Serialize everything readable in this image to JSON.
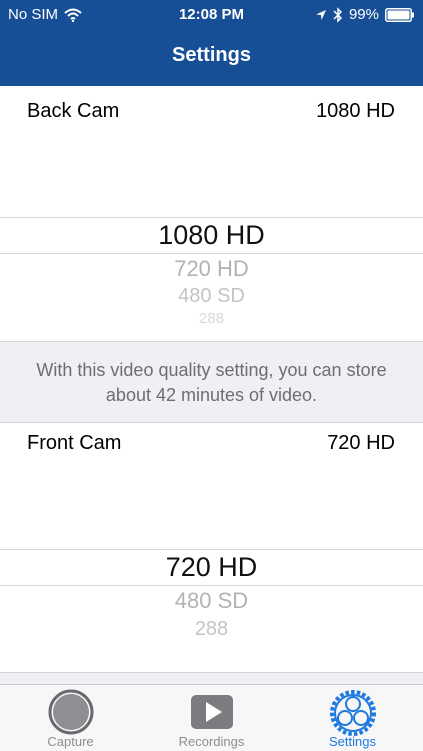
{
  "status_bar": {
    "carrier": "No SIM",
    "time": "12:08 PM",
    "battery": "99%"
  },
  "nav": {
    "title": "Settings"
  },
  "back_cam": {
    "label": "Back Cam",
    "value": "1080 HD",
    "picker_options": [
      "1080 HD",
      "720 HD",
      "480 SD",
      "288"
    ]
  },
  "info": {
    "text": "With this video quality setting, you can store about 42 minutes of video."
  },
  "front_cam": {
    "label": "Front Cam",
    "value": "720 HD",
    "picker_options": [
      "720 HD",
      "480 SD",
      "288"
    ]
  },
  "tabs": [
    {
      "label": "Capture",
      "icon": "capture-icon",
      "active": false
    },
    {
      "label": "Recordings",
      "icon": "play-icon",
      "active": false
    },
    {
      "label": "Settings",
      "icon": "settings-gear-icon",
      "active": true
    }
  ],
  "colors": {
    "nav_background": "#164f96",
    "active_tab": "#1f7ae0",
    "group_background": "#efeff4"
  }
}
